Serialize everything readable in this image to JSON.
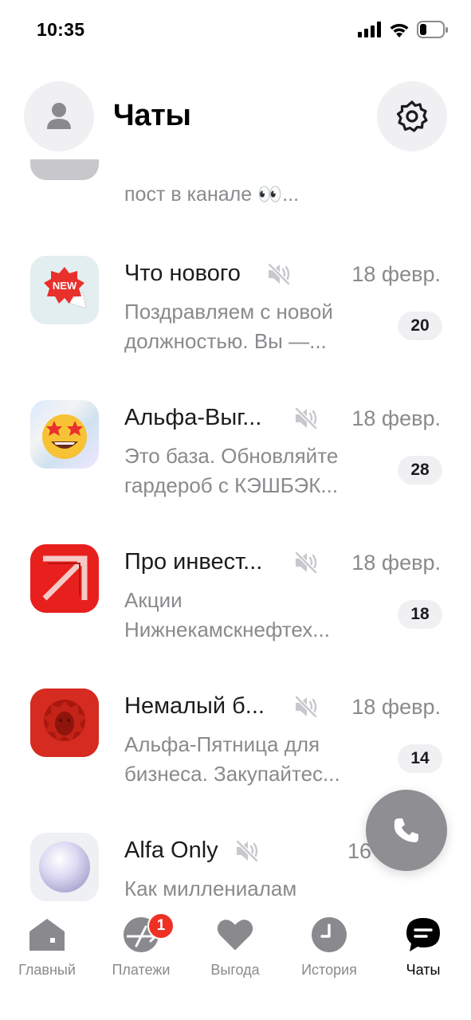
{
  "status_bar": {
    "time": "10:35"
  },
  "header": {
    "title": "Чаты"
  },
  "chats": {
    "partial_preview": "пост в канале 👀...",
    "items": [
      {
        "name": "Что нового",
        "date": "18 февр.",
        "preview_line1": "Поздравляем с новой",
        "preview_line2": "должностью. Вы —...",
        "unread": "20"
      },
      {
        "name": "Альфа-Выг...",
        "date": "18 февр.",
        "preview_line1": "Это база. Обновляйте",
        "preview_line2": "гардероб с КЭШБЭК...",
        "unread": "28"
      },
      {
        "name": "Про инвест...",
        "date": "18 февр.",
        "preview_line1": "Акции",
        "preview_line2": "Нижнекамскнефтех...",
        "unread": "18"
      },
      {
        "name": "Немалый б...",
        "date": "18 февр.",
        "preview_line1": "Альфа-Пятница для",
        "preview_line2": "бизнеса. Закупайтес...",
        "unread": "14"
      },
      {
        "name": "Alfa Only",
        "date": "16",
        "preview_line1": "Как миллениалам",
        "preview_line2": ""
      }
    ]
  },
  "icons": {
    "new_sticker_text": "NEW"
  },
  "tab_bar": {
    "tabs": [
      {
        "label": "Главный",
        "icon": "home-icon"
      },
      {
        "label": "Платежи",
        "icon": "payments-icon",
        "badge": "1"
      },
      {
        "label": "Выгода",
        "icon": "heart-icon"
      },
      {
        "label": "История",
        "icon": "clock-icon"
      },
      {
        "label": "Чаты",
        "icon": "chat-icon",
        "active": true
      }
    ]
  },
  "colors": {
    "accent_red": "#ef3124",
    "muted_gray": "#8a8a8e",
    "badge_bg": "#f0f0f2",
    "fab_gray": "#8e8e93"
  }
}
